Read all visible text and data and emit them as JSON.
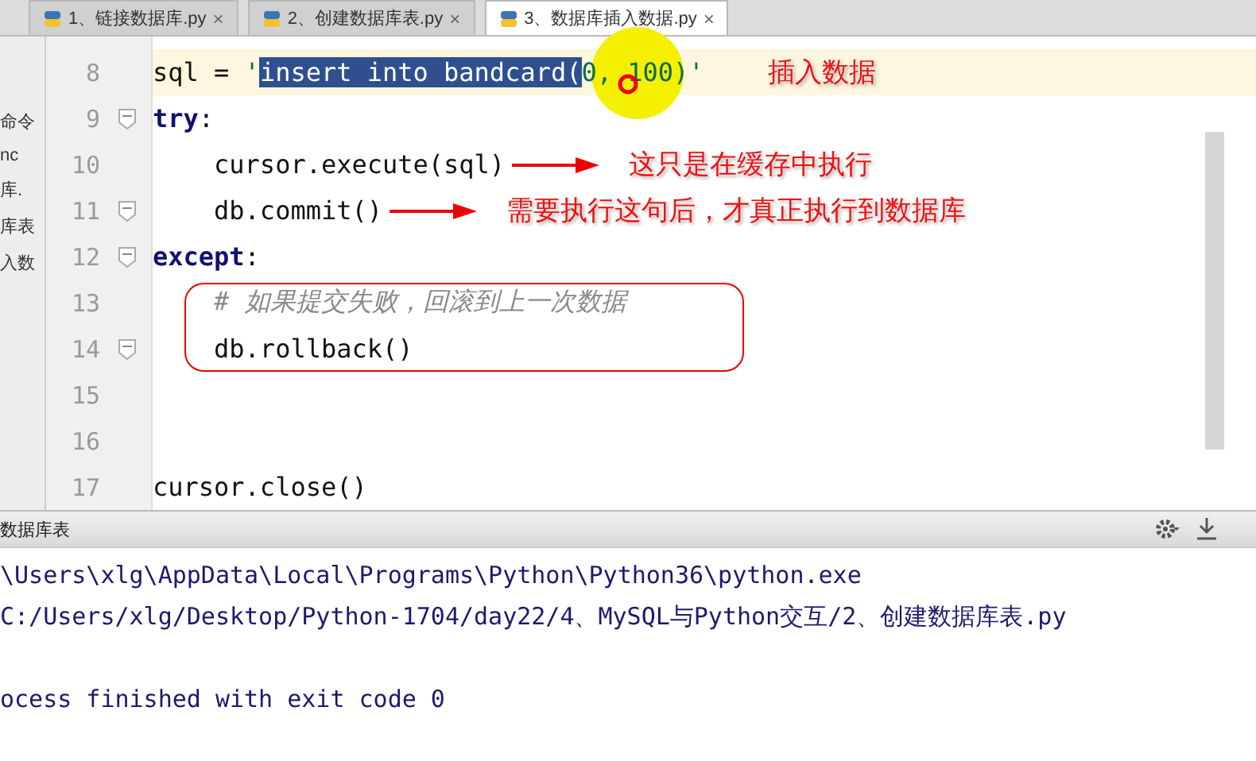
{
  "tabs": [
    {
      "label": "1、链接数据库.py",
      "selected": false,
      "close": "×"
    },
    {
      "label": "2、创建数据库表.py",
      "selected": false,
      "close": "×"
    },
    {
      "label": "3、数据库插入数据.py",
      "selected": true,
      "close": "×"
    }
  ],
  "sidebar_fragments": [
    "命令",
    "nc",
    "库.",
    "库表",
    "入数"
  ],
  "code_lines": [
    {
      "number": "8",
      "current": true,
      "fold": false,
      "boxed": false,
      "tokens": [
        {
          "text": "sql = ",
          "kind": "plain"
        },
        {
          "text": "'",
          "kind": "string"
        },
        {
          "text": "insert into bandcard(",
          "kind": "selected"
        },
        {
          "text": "0, 100)'",
          "kind": "string"
        }
      ],
      "note": "插入数据",
      "arrow": false
    },
    {
      "number": "9",
      "current": false,
      "fold": true,
      "boxed": false,
      "tokens": [
        {
          "text": "try",
          "kind": "keyword"
        },
        {
          "text": ":",
          "kind": "plain"
        }
      ]
    },
    {
      "number": "10",
      "current": false,
      "fold": false,
      "boxed": false,
      "tokens": [
        {
          "text": "    cursor.execute(sql)",
          "kind": "plain"
        }
      ],
      "note": "这只是在缓存中执行",
      "arrow": true
    },
    {
      "number": "11",
      "current": false,
      "fold": true,
      "boxed": false,
      "tokens": [
        {
          "text": "    db.commit()",
          "kind": "plain"
        }
      ],
      "note": "需要执行这句后，才真正执行到数据库",
      "arrow": true
    },
    {
      "number": "12",
      "current": false,
      "fold": true,
      "boxed": false,
      "tokens": [
        {
          "text": "except",
          "kind": "keyword"
        },
        {
          "text": ":",
          "kind": "plain"
        }
      ]
    },
    {
      "number": "13",
      "current": false,
      "fold": false,
      "boxed": true,
      "tokens": [
        {
          "text": "    # 如果提交失败，回滚到上一次数据",
          "kind": "comment"
        }
      ]
    },
    {
      "number": "14",
      "current": false,
      "fold": true,
      "boxed": true,
      "tokens": [
        {
          "text": "    db.rollback()",
          "kind": "plain"
        }
      ]
    },
    {
      "number": "15",
      "current": false,
      "fold": false,
      "boxed": false
    },
    {
      "number": "16",
      "current": false,
      "fold": false,
      "boxed": false
    },
    {
      "number": "17",
      "current": false,
      "fold": false,
      "boxed": false,
      "tokens": [
        {
          "text": "cursor.close()",
          "kind": "plain"
        }
      ]
    }
  ],
  "run_panel": {
    "title": "数据库表",
    "lines": [
      {
        "text": "\\Users\\xlg\\AppData\\Local\\Programs\\Python\\Python36\\python.exe",
        "kind": "output"
      },
      {
        "text": "C:/Users/xlg/Desktop/Python-1704/day22/4、MySQL与Python交互/2、创建数据库表.py",
        "kind": "output"
      },
      {
        "text": "ocess finished with exit code 0",
        "kind": "status"
      }
    ]
  }
}
